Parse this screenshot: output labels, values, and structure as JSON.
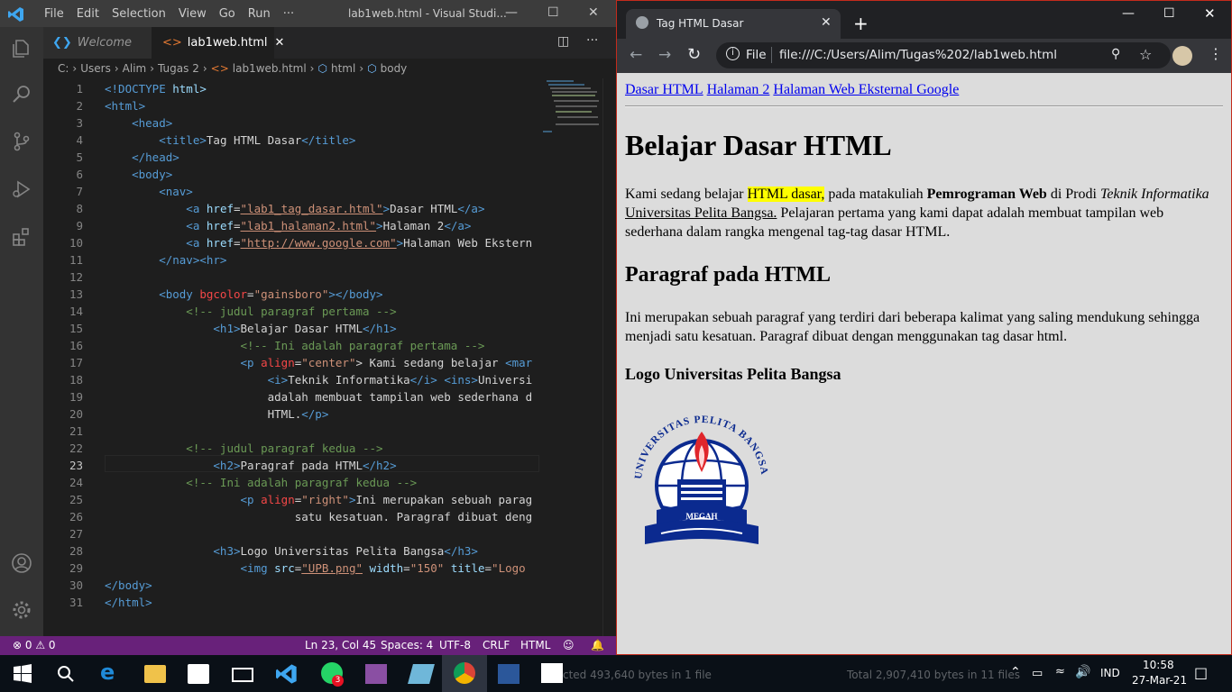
{
  "vscode": {
    "menu": [
      "File",
      "Edit",
      "Selection",
      "View",
      "Go",
      "Run",
      "···"
    ],
    "window_title": "lab1web.html - Visual Studi...",
    "tabs": [
      {
        "label": "Welcome"
      },
      {
        "label": "lab1web.html"
      }
    ],
    "breadcrumb": [
      "C:",
      "Users",
      "Alim",
      "Tugas 2",
      "lab1web.html",
      "html",
      "body"
    ],
    "code_lines": [
      [
        [
          "!DOCTYPE",
          "t"
        ],
        [
          " html",
          "a"
        ]
      ],
      [
        [
          "<html>",
          "t"
        ]
      ],
      [
        [
          "    <head>",
          "t"
        ]
      ],
      [
        [
          "        <title>",
          "t"
        ],
        [
          "Tag HTML Dasar",
          ""
        ],
        [
          "</title>",
          "t"
        ]
      ],
      [
        [
          "    </head>",
          "t"
        ]
      ],
      [
        [
          "    <body>",
          "t"
        ]
      ],
      [
        [
          "        <nav>",
          "t"
        ]
      ],
      [
        [
          "            <a ",
          "t"
        ],
        [
          "href",
          "a"
        ],
        [
          "=",
          ""
        ],
        [
          "\"lab1_tag_dasar.html\"",
          "su"
        ],
        [
          ">",
          "t"
        ],
        [
          "Dasar HTML",
          ""
        ],
        [
          "</a>",
          "t"
        ]
      ],
      [
        [
          "            <a ",
          "t"
        ],
        [
          "href",
          "a"
        ],
        [
          "=",
          ""
        ],
        [
          "\"lab1_halaman2.html\"",
          "su"
        ],
        [
          ">",
          "t"
        ],
        [
          "Halaman 2",
          ""
        ],
        [
          "</a>",
          "t"
        ]
      ],
      [
        [
          "            <a ",
          "t"
        ],
        [
          "href",
          "a"
        ],
        [
          "=",
          ""
        ],
        [
          "\"http://www.google.com\"",
          "su"
        ],
        [
          ">",
          "t"
        ],
        [
          "Halaman Web Ekstern",
          ""
        ]
      ],
      [
        [
          "        </nav><hr>",
          "t"
        ]
      ],
      [
        [
          "",
          ""
        ]
      ],
      [
        [
          "        <body ",
          "t"
        ],
        [
          "bgcolor",
          "r"
        ],
        [
          "=",
          ""
        ],
        [
          "\"gainsboro\"",
          "s"
        ],
        [
          "></body>",
          "t"
        ]
      ],
      [
        [
          "            <!-- judul paragraf pertama -->",
          "c"
        ]
      ],
      [
        [
          "                <h1>",
          "t"
        ],
        [
          "Belajar Dasar HTML",
          ""
        ],
        [
          "</h1>",
          "t"
        ]
      ],
      [
        [
          "                    <!-- Ini adalah paragraf pertama -->",
          "c"
        ]
      ],
      [
        [
          "                    <p ",
          "t"
        ],
        [
          "align",
          "r"
        ],
        [
          "=",
          ""
        ],
        [
          "\"center\"",
          "s"
        ],
        [
          ">",
          ""
        ],
        [
          " Kami sedang belajar ",
          ""
        ],
        [
          "<mar",
          "t"
        ]
      ],
      [
        [
          "                        <i>",
          "t"
        ],
        [
          "Teknik Informatika",
          ""
        ],
        [
          "</i>",
          "t"
        ],
        [
          " ",
          ""
        ],
        [
          "<ins>",
          "t"
        ],
        [
          "Universi",
          ""
        ]
      ],
      [
        [
          "                        adalah membuat tampilan web sederhana d",
          ""
        ]
      ],
      [
        [
          "                        HTML.",
          ""
        ],
        [
          "</p>",
          "t"
        ]
      ],
      [
        [
          "",
          ""
        ]
      ],
      [
        [
          "            <!-- judul paragraf kedua -->",
          "c"
        ]
      ],
      [
        [
          "                <h2>",
          "t"
        ],
        [
          "Paragraf pada HTML",
          ""
        ],
        [
          "</h2>",
          "t"
        ]
      ],
      [
        [
          "            <!-- Ini adalah paragraf kedua -->",
          "c"
        ]
      ],
      [
        [
          "                    <p ",
          "t"
        ],
        [
          "align",
          "r"
        ],
        [
          "=",
          ""
        ],
        [
          "\"right\"",
          "s"
        ],
        [
          ">",
          "t"
        ],
        [
          "Ini merupakan sebuah parag",
          ""
        ]
      ],
      [
        [
          "                            satu kesatuan. Paragraf dibuat deng",
          ""
        ]
      ],
      [
        [
          "",
          ""
        ]
      ],
      [
        [
          "                <h3>",
          "t"
        ],
        [
          "Logo Universitas Pelita Bangsa",
          ""
        ],
        [
          "</h3>",
          "t"
        ]
      ],
      [
        [
          "                    <img ",
          "t"
        ],
        [
          "src",
          "a"
        ],
        [
          "=",
          ""
        ],
        [
          "\"UPB.png\"",
          "su"
        ],
        [
          " ",
          ""
        ],
        [
          "width",
          "a"
        ],
        [
          "=",
          ""
        ],
        [
          "\"150\"",
          "s"
        ],
        [
          " ",
          ""
        ],
        [
          "title",
          "a"
        ],
        [
          "=",
          ""
        ],
        [
          "\"Logo",
          "s"
        ]
      ],
      [
        [
          "</body>",
          "t"
        ]
      ],
      [
        [
          "</html>",
          "t"
        ]
      ]
    ],
    "status": {
      "errors": "0",
      "warnings": "0",
      "position": "Ln 23, Col 45",
      "spaces": "Spaces: 4",
      "encoding": "UTF-8",
      "eol": "CRLF",
      "language": "HTML"
    }
  },
  "browser": {
    "tab_title": "Tag HTML Dasar",
    "scheme_label": "File",
    "url": "file:///C:/Users/Alim/Tugas%202/lab1web.html",
    "page": {
      "nav": [
        "Dasar HTML",
        "Halaman 2",
        "Halaman Web Eksternal Google"
      ],
      "h1": "Belajar Dasar HTML",
      "p1": {
        "before": "Kami sedang belajar ",
        "mark": "HTML dasar,",
        "mid": " pada matakuliah ",
        "bold": "Pemrograman Web",
        "mid2": " di Prodi ",
        "italic": "Teknik Informatika",
        "space": " ",
        "ins": "Universitas Pelita Bangsa.",
        "after": " Pelajaran pertama yang kami dapat adalah membuat tampilan web sederhana dalam rangka mengenal tag-tag dasar HTML."
      },
      "h2": "Paragraf pada HTML",
      "p2": "Ini merupakan sebuah paragraf yang terdiri dari beberapa kalimat yang saling mendukung sehingga menjadi satu kesatuan. Paragraf dibuat dengan menggunakan tag dasar html.",
      "h3": "Logo Universitas Pelita Bangsa",
      "logo": {
        "arc_text": "UNIVERSITAS PELITA BANGSA",
        "banner": "MEGAH"
      }
    }
  },
  "taskbar": {
    "behind_text_1": "cted 493,640 bytes in 1 file",
    "behind_text_2": "Total 2,907,410 bytes in 11 files",
    "badge": "3",
    "lang": "IND",
    "time": "10:58",
    "date": "27-Mar-21"
  }
}
